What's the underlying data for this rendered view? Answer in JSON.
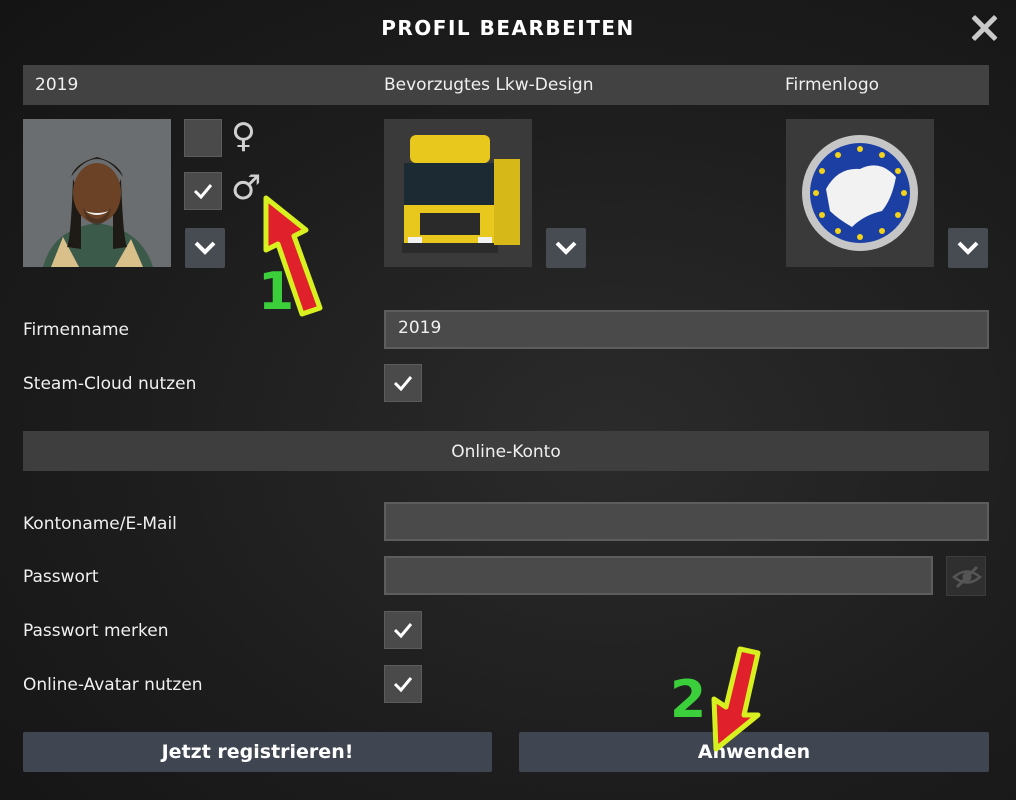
{
  "dialog": {
    "title": "PROFIL BEARBEITEN",
    "close_icon": "close-icon"
  },
  "header": {
    "profile_name": "2019",
    "truck_design_label": "Bevorzugtes Lkw-Design",
    "company_logo_label": "Firmenlogo"
  },
  "gender": {
    "female_symbol": "♀",
    "male_symbol": "♂",
    "female_checked": false,
    "male_checked": true
  },
  "form": {
    "company_name_label": "Firmenname",
    "company_name_value": "2019",
    "steam_cloud_label": "Steam-Cloud nutzen",
    "steam_cloud_checked": true
  },
  "online": {
    "section_title": "Online-Konto",
    "account_label": "Kontoname/E-Mail",
    "account_value": "",
    "password_label": "Passwort",
    "password_value": "",
    "remember_password_label": "Passwort merken",
    "remember_password_checked": true,
    "online_avatar_label": "Online-Avatar nutzen",
    "online_avatar_checked": true
  },
  "buttons": {
    "register_label": "Jetzt registrieren!",
    "apply_label": "Anwenden"
  },
  "annotations": {
    "step1": "1",
    "step2": "2",
    "arrow_fill": "#e0202a",
    "arrow_outline": "#d8f020",
    "number_color": "#3ccf3c"
  },
  "colors": {
    "background": "#1d1d1d",
    "bar": "#424242",
    "button": "#3f4651",
    "checkbox": "#4a4a4a"
  }
}
